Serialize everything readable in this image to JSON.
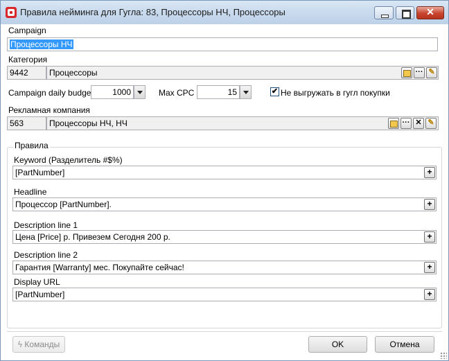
{
  "window": {
    "title": "Правила нейминга для Гугла: 83, Процессоры НЧ, Процессоры",
    "icon": "app-logo-icon",
    "close_glyph": "✕"
  },
  "campaign": {
    "label": "Campaign",
    "value": "Процессоры НЧ"
  },
  "category": {
    "label": "Категория",
    "id": "9442",
    "name": "Процессоры",
    "buttons": [
      "select-icon",
      "ellipsis-icon",
      "edit-icon"
    ],
    "ellipsis_glyph": "···",
    "edit_glyph": "✎"
  },
  "budget": {
    "label": "Campaign daily budget",
    "value": "1000",
    "max_cpc_label": "Max CPC",
    "max_cpc_value": "15",
    "checkbox_checked": true,
    "checkbox_glyph": "✔",
    "checkbox_label": "Не выгружать в гугл покупки"
  },
  "ad_company": {
    "label": "Рекламная компания",
    "id": "563",
    "name": "Процессоры НЧ, НЧ",
    "buttons": [
      "select-icon",
      "ellipsis-icon",
      "clear-icon",
      "edit-icon"
    ],
    "clear_glyph": "✕"
  },
  "rules": {
    "group_label": "Правила",
    "plus_glyph": "+",
    "fields": [
      {
        "label": "Keyword (Разделитель #$%)",
        "value": "[PartNumber]"
      },
      {
        "label": "Headline",
        "value": "Процессор [PartNumber]."
      },
      {
        "label": "Description line 1",
        "value": "Цена [Price] р. Привезем Сегодня 200 р."
      },
      {
        "label": "Description line 2",
        "value": "Гарантия [Warranty] мес. Покупайте сейчас!"
      },
      {
        "label": "Display URL",
        "value": "[PartNumber]"
      }
    ]
  },
  "footer": {
    "commands_label": "Команды",
    "ok_label": "OK",
    "cancel_label": "Отмена"
  },
  "colors": {
    "selection": "#3399ff",
    "close_button": "#c8442e",
    "title_bar": "#c6d8ec",
    "brand": "#d8282c"
  }
}
